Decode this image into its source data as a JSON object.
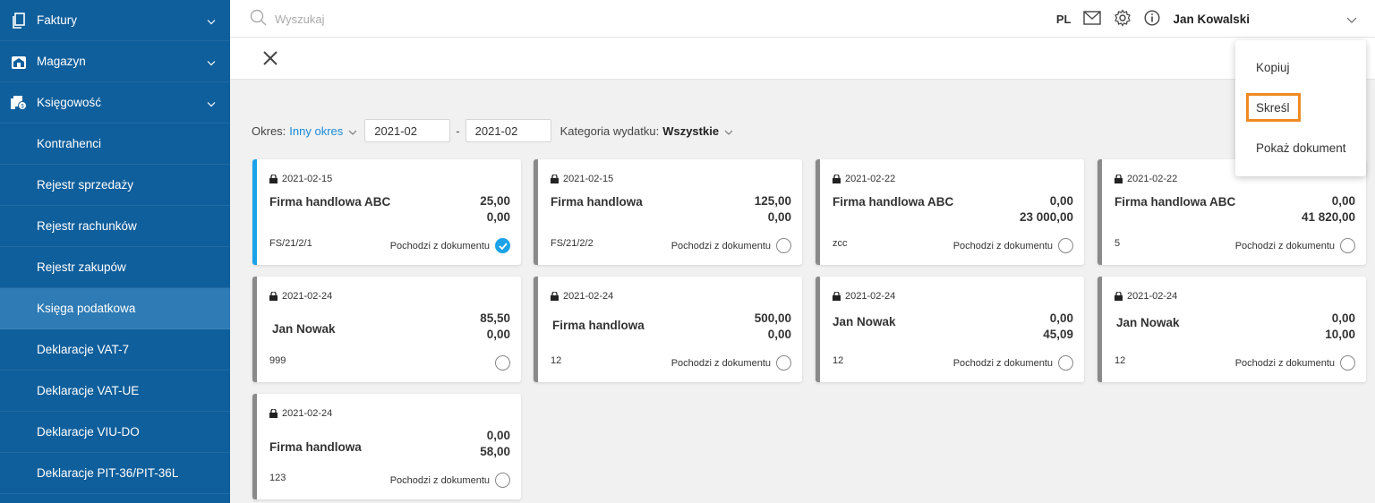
{
  "sidebar": {
    "items": [
      {
        "label": "Faktury",
        "icon": "document-copy-icon"
      },
      {
        "label": "Magazyn",
        "icon": "warehouse-icon"
      },
      {
        "label": "Księgowość",
        "icon": "accounting-icon"
      }
    ],
    "subitems": [
      {
        "label": "Kontrahenci"
      },
      {
        "label": "Rejestr sprzedaży"
      },
      {
        "label": "Rejestr rachunków"
      },
      {
        "label": "Rejestr zakupów"
      },
      {
        "label": "Księga podatkowa",
        "active": true
      },
      {
        "label": "Deklaracje VAT-7"
      },
      {
        "label": "Deklaracje VAT-UE"
      },
      {
        "label": "Deklaracje VIU-DO"
      },
      {
        "label": "Deklaracje PIT-36/PIT-36L"
      }
    ]
  },
  "topbar": {
    "search_placeholder": "Wyszukaj",
    "lang": "PL",
    "user": "Jan Kowalski"
  },
  "filters": {
    "period_label": "Okres:",
    "period_value": "Inny okres",
    "date_from": "2021-02",
    "date_sep": "-",
    "date_to": "2021-02",
    "category_label": "Kategoria wydatku:",
    "category_value": "Wszystkie"
  },
  "cards": [
    {
      "date": "2021-02-15",
      "name": "Firma handlowa ABC",
      "v1": "25,00",
      "v2": "0,00",
      "num": "FS/21/2/1",
      "origin": "Pochodzi z dokumentu",
      "checked": true
    },
    {
      "date": "2021-02-15",
      "name": "Firma handlowa",
      "v1": "125,00",
      "v2": "0,00",
      "num": "FS/21/2/2",
      "origin": "Pochodzi z dokumentu",
      "checked": false
    },
    {
      "date": "2021-02-22",
      "name": "Firma handlowa ABC",
      "v1": "0,00",
      "v2": "23 000,00",
      "num": "zcc",
      "origin": "Pochodzi z dokumentu",
      "checked": false
    },
    {
      "date": "2021-02-22",
      "name": "Firma handlowa ABC",
      "v1": "0,00",
      "v2": "41 820,00",
      "num": "5",
      "origin": "Pochodzi z dokumentu",
      "checked": false
    },
    {
      "date": "2021-02-24",
      "name": "Jan Nowak",
      "v1": "85,50",
      "v2": "0,00",
      "num": "999",
      "origin": "",
      "checked": false
    },
    {
      "date": "2021-02-24",
      "name": "Firma handlowa",
      "v1": "500,00",
      "v2": "0,00",
      "num": "12",
      "origin": "Pochodzi z dokumentu",
      "checked": false
    },
    {
      "date": "2021-02-24",
      "name": "Jan Nowak",
      "v1": "0,00",
      "v2": "45,09",
      "num": "12",
      "origin": "Pochodzi z dokumentu",
      "checked": false
    },
    {
      "date": "2021-02-24",
      "name": "Jan Nowak",
      "v1": "0,00",
      "v2": "10,00",
      "num": "12",
      "origin": "Pochodzi z dokumentu",
      "checked": false
    },
    {
      "date": "2021-02-24",
      "name": "Firma handlowa",
      "v1": "0,00",
      "v2": "58,00",
      "num": "123",
      "origin": "Pochodzi z dokumentu",
      "checked": false
    }
  ],
  "menu": {
    "items": [
      "Kopiuj",
      "Skreśl",
      "Pokaż dokument"
    ],
    "highlight_color": "#f08a24"
  },
  "colors": {
    "sidebar_bg": "#0f5f9c",
    "sidebar_active": "#2e7bb5",
    "accent": "#1aa3e8",
    "link": "#1a8ad8"
  }
}
